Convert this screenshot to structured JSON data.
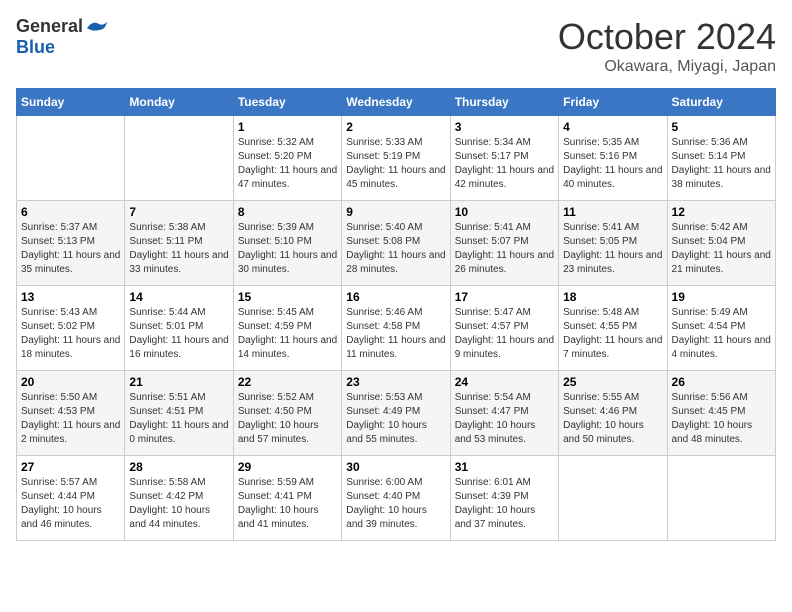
{
  "header": {
    "logo_general": "General",
    "logo_blue": "Blue",
    "month": "October 2024",
    "location": "Okawara, Miyagi, Japan"
  },
  "calendar": {
    "days_of_week": [
      "Sunday",
      "Monday",
      "Tuesday",
      "Wednesday",
      "Thursday",
      "Friday",
      "Saturday"
    ],
    "weeks": [
      [
        {
          "day": "",
          "info": ""
        },
        {
          "day": "",
          "info": ""
        },
        {
          "day": "1",
          "sunrise": "5:32 AM",
          "sunset": "5:20 PM",
          "daylight": "11 hours and 47 minutes."
        },
        {
          "day": "2",
          "sunrise": "5:33 AM",
          "sunset": "5:19 PM",
          "daylight": "11 hours and 45 minutes."
        },
        {
          "day": "3",
          "sunrise": "5:34 AM",
          "sunset": "5:17 PM",
          "daylight": "11 hours and 42 minutes."
        },
        {
          "day": "4",
          "sunrise": "5:35 AM",
          "sunset": "5:16 PM",
          "daylight": "11 hours and 40 minutes."
        },
        {
          "day": "5",
          "sunrise": "5:36 AM",
          "sunset": "5:14 PM",
          "daylight": "11 hours and 38 minutes."
        }
      ],
      [
        {
          "day": "6",
          "sunrise": "5:37 AM",
          "sunset": "5:13 PM",
          "daylight": "11 hours and 35 minutes."
        },
        {
          "day": "7",
          "sunrise": "5:38 AM",
          "sunset": "5:11 PM",
          "daylight": "11 hours and 33 minutes."
        },
        {
          "day": "8",
          "sunrise": "5:39 AM",
          "sunset": "5:10 PM",
          "daylight": "11 hours and 30 minutes."
        },
        {
          "day": "9",
          "sunrise": "5:40 AM",
          "sunset": "5:08 PM",
          "daylight": "11 hours and 28 minutes."
        },
        {
          "day": "10",
          "sunrise": "5:41 AM",
          "sunset": "5:07 PM",
          "daylight": "11 hours and 26 minutes."
        },
        {
          "day": "11",
          "sunrise": "5:41 AM",
          "sunset": "5:05 PM",
          "daylight": "11 hours and 23 minutes."
        },
        {
          "day": "12",
          "sunrise": "5:42 AM",
          "sunset": "5:04 PM",
          "daylight": "11 hours and 21 minutes."
        }
      ],
      [
        {
          "day": "13",
          "sunrise": "5:43 AM",
          "sunset": "5:02 PM",
          "daylight": "11 hours and 18 minutes."
        },
        {
          "day": "14",
          "sunrise": "5:44 AM",
          "sunset": "5:01 PM",
          "daylight": "11 hours and 16 minutes."
        },
        {
          "day": "15",
          "sunrise": "5:45 AM",
          "sunset": "4:59 PM",
          "daylight": "11 hours and 14 minutes."
        },
        {
          "day": "16",
          "sunrise": "5:46 AM",
          "sunset": "4:58 PM",
          "daylight": "11 hours and 11 minutes."
        },
        {
          "day": "17",
          "sunrise": "5:47 AM",
          "sunset": "4:57 PM",
          "daylight": "11 hours and 9 minutes."
        },
        {
          "day": "18",
          "sunrise": "5:48 AM",
          "sunset": "4:55 PM",
          "daylight": "11 hours and 7 minutes."
        },
        {
          "day": "19",
          "sunrise": "5:49 AM",
          "sunset": "4:54 PM",
          "daylight": "11 hours and 4 minutes."
        }
      ],
      [
        {
          "day": "20",
          "sunrise": "5:50 AM",
          "sunset": "4:53 PM",
          "daylight": "11 hours and 2 minutes."
        },
        {
          "day": "21",
          "sunrise": "5:51 AM",
          "sunset": "4:51 PM",
          "daylight": "11 hours and 0 minutes."
        },
        {
          "day": "22",
          "sunrise": "5:52 AM",
          "sunset": "4:50 PM",
          "daylight": "10 hours and 57 minutes."
        },
        {
          "day": "23",
          "sunrise": "5:53 AM",
          "sunset": "4:49 PM",
          "daylight": "10 hours and 55 minutes."
        },
        {
          "day": "24",
          "sunrise": "5:54 AM",
          "sunset": "4:47 PM",
          "daylight": "10 hours and 53 minutes."
        },
        {
          "day": "25",
          "sunrise": "5:55 AM",
          "sunset": "4:46 PM",
          "daylight": "10 hours and 50 minutes."
        },
        {
          "day": "26",
          "sunrise": "5:56 AM",
          "sunset": "4:45 PM",
          "daylight": "10 hours and 48 minutes."
        }
      ],
      [
        {
          "day": "27",
          "sunrise": "5:57 AM",
          "sunset": "4:44 PM",
          "daylight": "10 hours and 46 minutes."
        },
        {
          "day": "28",
          "sunrise": "5:58 AM",
          "sunset": "4:42 PM",
          "daylight": "10 hours and 44 minutes."
        },
        {
          "day": "29",
          "sunrise": "5:59 AM",
          "sunset": "4:41 PM",
          "daylight": "10 hours and 41 minutes."
        },
        {
          "day": "30",
          "sunrise": "6:00 AM",
          "sunset": "4:40 PM",
          "daylight": "10 hours and 39 minutes."
        },
        {
          "day": "31",
          "sunrise": "6:01 AM",
          "sunset": "4:39 PM",
          "daylight": "10 hours and 37 minutes."
        },
        {
          "day": "",
          "info": ""
        },
        {
          "day": "",
          "info": ""
        }
      ]
    ]
  }
}
